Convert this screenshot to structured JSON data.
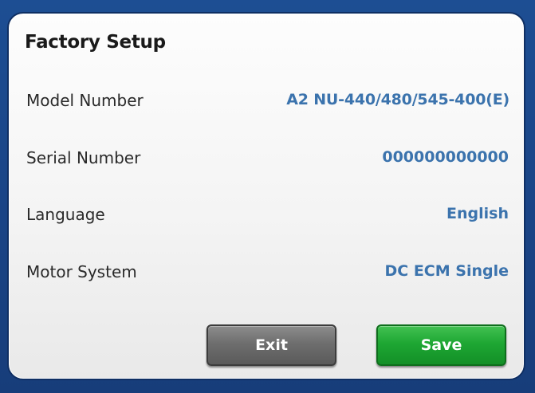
{
  "screen": {
    "title": "Factory Setup"
  },
  "settings": [
    {
      "label": "Model Number",
      "value": "A2 NU-440/480/545-400(E)"
    },
    {
      "label": "Serial Number",
      "value": "000000000000"
    },
    {
      "label": "Language",
      "value": "English"
    },
    {
      "label": "Motor System",
      "value": "DC ECM Single"
    }
  ],
  "buttons": {
    "exit_label": "Exit",
    "save_label": "Save"
  },
  "colors": {
    "background": "#1d4e93",
    "value_text": "#3b73ad",
    "exit_button": "#6e6e6e",
    "save_button": "#1ea733"
  }
}
